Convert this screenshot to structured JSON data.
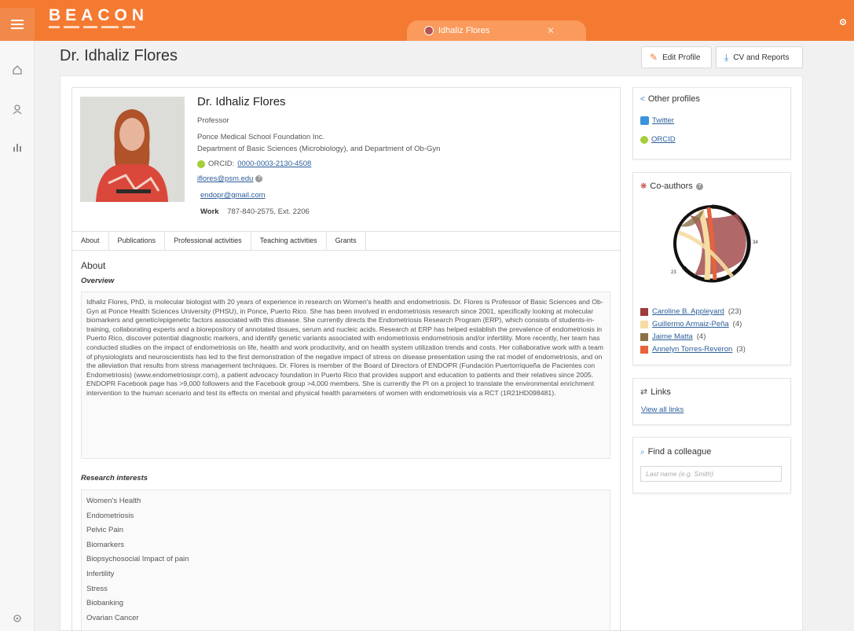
{
  "app": {
    "logo_text": "BEACON",
    "tab_title": "Idhaliz Flores",
    "tab_close": "✕"
  },
  "header": {
    "page_title": "Dr. Idhaliz Flores",
    "edit_profile": "Edit Profile",
    "cv_reports": "CV and Reports"
  },
  "profile": {
    "name": "Dr. Idhaliz Flores",
    "role": "Professor",
    "organization": "Ponce Medical School Foundation Inc.",
    "department": "Department of Basic Sciences (Microbiology), and Department of Ob-Gyn",
    "orcid_label": "ORCID:",
    "orcid_id": "0000-0003-2130-4508",
    "email_primary": "iflores@psm.edu",
    "email_secondary": "endopr@gmail.com",
    "work_label": "Work",
    "work_phone": "787-840-2575, Ext. 2206"
  },
  "tabs": [
    "About",
    "Publications",
    "Professional activities",
    "Teaching activities",
    "Grants"
  ],
  "about": {
    "heading": "About",
    "overview_heading": "Overview",
    "overview_text": "Idhaliz Flores, PhD, is molecular biologist with 20 years of experience in research on Women's health and endometriosis. Dr. Flores is Professor of Basic Sciences and Ob-Gyn at Ponce Health Sciences University (PHSU), in Ponce, Puerto Rico. She has been involved in endometriosis research since 2001, specifically looking at molecular biomarkers and genetic/epigenetic factors associated with this disease. She currently directs the Endometriosis Research Program (ERP), which consists of students-in-training, collaborating experts and a biorepository of annotated tissues, serum and nucleic acids. Research at ERP has helped establish the prevalence of endometriosis in Puerto Rico, discover potential diagnostic markers, and identify genetic variants associated with endometriosis endometriosis and/or infertility. More recently, her team has conducted studies on the impact of endometriosis on life, health and work productivity, and on health system utilization trends and costs. Her collaborative work with a team of physiologists and neuroscientists has led to the first demonstration of the negative impact of stress on disease presentation using the rat model of endometriosis, and on the alleviation that results from stress management techniques. Dr. Flores is member of the Board of Directors of ENDOPR (Fundación Puertorriqueña de Pacientes con Endometriosis) (www.endometriosispr.com), a patient advocacy foundation in Puerto Rico that provides support and education to patients and their relatives since 2005. ENDOPR Facebook page has >9,000 followers and the Facebook group >4,000 members. She is currently the PI on a project to translate the environmental enrichment intervention to the human scenario and test its effects on mental and physical health parameters of women with endometriosis via a RCT (1R21HD098481).",
    "research_heading": "Research interests",
    "research_interests": [
      "Women's Health",
      "Endometriosis",
      "Pelvic Pain",
      "Biomarkers",
      "Biopsychosocial Impact of pain",
      "Infertility",
      "Stress",
      "Biobanking",
      "Ovarian Cancer"
    ]
  },
  "other_profiles": {
    "title": "Other profiles",
    "twitter": "Twitter",
    "orcid": "ORCID"
  },
  "coauthors": {
    "title": "Co-authors",
    "label_34": "34",
    "label_23": "23",
    "legend": [
      {
        "name": "Caroline B. Appleyard",
        "count": "(23)",
        "color": "#9e3b3b"
      },
      {
        "name": "Guillermo Armaiz-Peña",
        "count": "(4)",
        "color": "#f6dca2"
      },
      {
        "name": "Jaime Matta",
        "count": "(4)",
        "color": "#8a7146"
      },
      {
        "name": "Annelyn Torres-Reveron",
        "count": "(3)",
        "color": "#e8623a"
      }
    ]
  },
  "links": {
    "title": "Links",
    "view_all": "View all links"
  },
  "find_colleague": {
    "title": "Find a colleague",
    "placeholder": "Last name (e.g. Smith)"
  },
  "icons": {
    "menu": "hamburger-icon",
    "home": "home-icon",
    "person": "person-icon",
    "chart": "chart-icon",
    "settings": "settings-icon"
  },
  "colors": {
    "brand_orange": "#f47a32",
    "link_blue": "#2d5f9a",
    "orcid_green": "#a6ce39",
    "twitter_blue": "#3b94d9"
  }
}
